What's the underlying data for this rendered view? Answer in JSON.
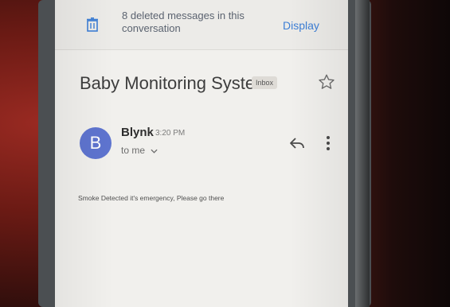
{
  "banner": {
    "deleted_text": "8 deleted messages in this conversation",
    "display_label": "Display"
  },
  "email": {
    "subject": "Baby Monitoring System",
    "label_badge": "Inbox",
    "sender_initial": "B",
    "sender_name": "Blynk",
    "time": "3:20 PM",
    "recipient": "to me",
    "body": "Smoke Detected it's emergency, Please go there"
  },
  "icons": [
    "trash-icon",
    "star-icon",
    "chevron-down-icon",
    "reply-icon",
    "more-vert-icon"
  ],
  "colors": {
    "accent": "#3d7fd6",
    "avatar": "#5e74cf",
    "screen_bg": "#f1f0ed"
  }
}
